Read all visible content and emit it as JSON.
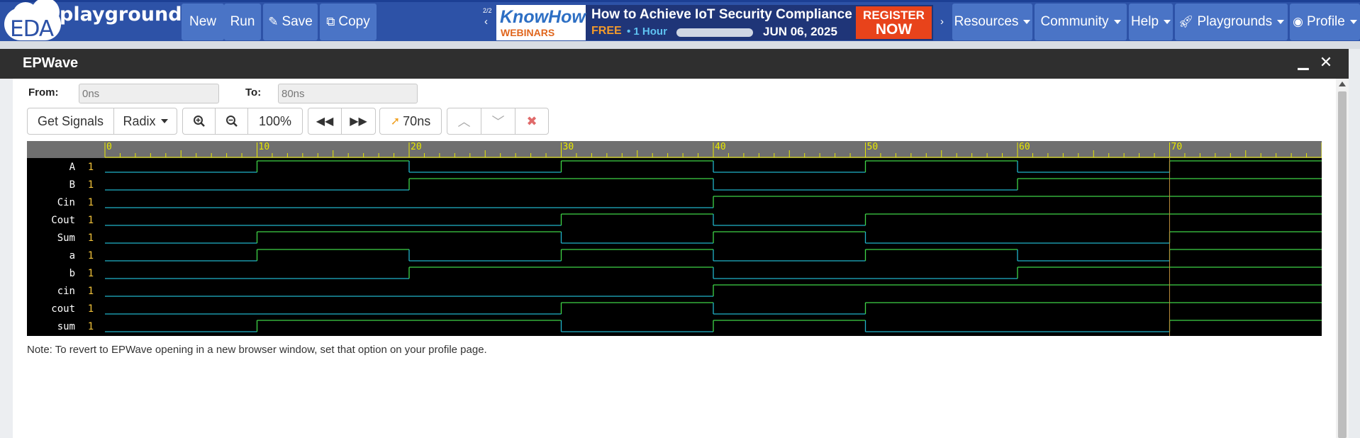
{
  "navbar": {
    "logo_eda": "EDA",
    "logo_playground": "playground",
    "buttons": [
      "New",
      "Run",
      "Save",
      "Copy"
    ],
    "ad_counter": "2/2",
    "ad": {
      "brand_top": "KnowHow",
      "brand_bottom": "WEBINARS",
      "headline": "How to Achieve IoT Security Compliance",
      "free": "FREE",
      "duration": "• 1 Hour",
      "date": "JUN 06, 2025",
      "register": "REGISTER",
      "now": "NOW"
    },
    "menus": [
      "Resources",
      "Community",
      "Help",
      "Playgrounds",
      "Profile"
    ]
  },
  "modal": {
    "title": "EPWave",
    "from_label": "From:",
    "from_value": "0ns",
    "to_label": "To:",
    "to_value": "80ns",
    "toolbar": {
      "get_signals": "Get Signals",
      "radix": "Radix",
      "zoom": "100%",
      "cursor": "70ns"
    },
    "note": "Note: To revert to EPWave opening in a new browser window, set that option on your profile page."
  },
  "waveform": {
    "time_range": [
      0,
      80
    ],
    "ticks": [
      0,
      10,
      20,
      30,
      40,
      50,
      60,
      70
    ],
    "cursor_time": 70,
    "colors": {
      "low": "#21b2c9",
      "high": "#3fd447",
      "value": "#f0c13a",
      "ruler_text": "#e8e800"
    },
    "signals": [
      {
        "name": "A",
        "value": "1",
        "edges": [
          [
            0,
            0
          ],
          [
            10,
            1
          ],
          [
            20,
            0
          ],
          [
            30,
            1
          ],
          [
            40,
            0
          ],
          [
            50,
            1
          ],
          [
            60,
            0
          ],
          [
            70,
            1
          ]
        ]
      },
      {
        "name": "B",
        "value": "1",
        "edges": [
          [
            0,
            0
          ],
          [
            20,
            1
          ],
          [
            40,
            0
          ],
          [
            60,
            1
          ]
        ]
      },
      {
        "name": "Cin",
        "value": "1",
        "edges": [
          [
            0,
            0
          ],
          [
            40,
            1
          ]
        ]
      },
      {
        "name": "Cout",
        "value": "1",
        "edges": [
          [
            0,
            0
          ],
          [
            30,
            1
          ],
          [
            40,
            0
          ],
          [
            50,
            1
          ]
        ]
      },
      {
        "name": "Sum",
        "value": "1",
        "edges": [
          [
            0,
            0
          ],
          [
            10,
            1
          ],
          [
            30,
            0
          ],
          [
            40,
            1
          ],
          [
            50,
            0
          ],
          [
            70,
            1
          ]
        ]
      },
      {
        "name": "a",
        "value": "1",
        "edges": [
          [
            0,
            0
          ],
          [
            10,
            1
          ],
          [
            20,
            0
          ],
          [
            30,
            1
          ],
          [
            40,
            0
          ],
          [
            50,
            1
          ],
          [
            60,
            0
          ],
          [
            70,
            1
          ]
        ]
      },
      {
        "name": "b",
        "value": "1",
        "edges": [
          [
            0,
            0
          ],
          [
            20,
            1
          ],
          [
            40,
            0
          ],
          [
            60,
            1
          ]
        ]
      },
      {
        "name": "cin",
        "value": "1",
        "edges": [
          [
            0,
            0
          ],
          [
            40,
            1
          ]
        ]
      },
      {
        "name": "cout",
        "value": "1",
        "edges": [
          [
            0,
            0
          ],
          [
            30,
            1
          ],
          [
            40,
            0
          ],
          [
            50,
            1
          ]
        ]
      },
      {
        "name": "sum",
        "value": "1",
        "edges": [
          [
            0,
            0
          ],
          [
            10,
            1
          ],
          [
            30,
            0
          ],
          [
            40,
            1
          ],
          [
            50,
            0
          ],
          [
            70,
            1
          ]
        ]
      }
    ]
  }
}
